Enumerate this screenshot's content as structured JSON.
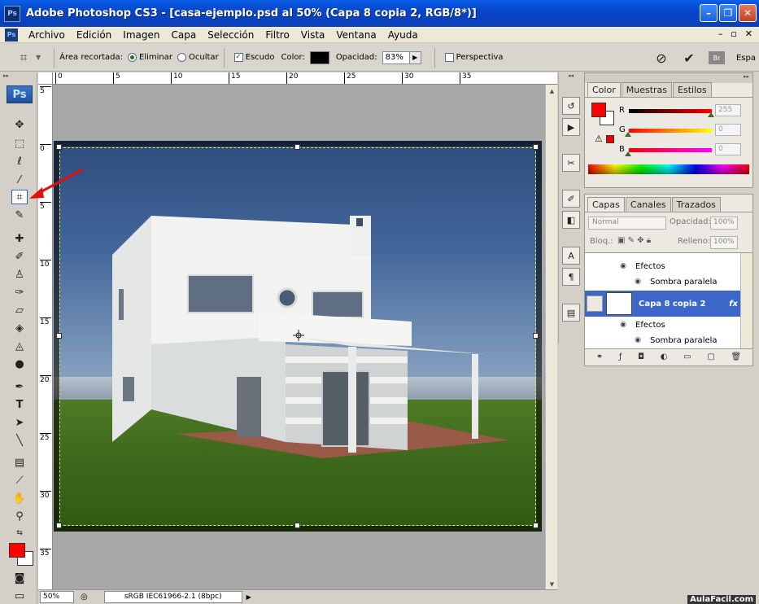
{
  "window": {
    "title": "Adobe Photoshop CS3 - [casa-ejemplo.psd al 50% (Capa 8 copia 2, RGB/8*)]",
    "app_icon_label": "Ps",
    "minimize": "–",
    "restore": "❐",
    "close": "✕"
  },
  "menu": {
    "icon_label": "Ps",
    "items": [
      "Archivo",
      "Edición",
      "Imagen",
      "Capa",
      "Selección",
      "Filtro",
      "Vista",
      "Ventana",
      "Ayuda"
    ],
    "doc_controls": [
      "–",
      "▫",
      "✕"
    ]
  },
  "options": {
    "cropped_area_label": "Área recortada:",
    "delete_label": "Eliminar",
    "hide_label": "Ocultar",
    "shield_label": "Escudo",
    "color_label": "Color:",
    "opacity_label": "Opacidad:",
    "opacity_value": "83%",
    "perspective_label": "Perspectiva",
    "workspace_label": "Espa",
    "bridge_label": "Br"
  },
  "toolbox": {
    "logo": "Ps"
  },
  "rulers": {
    "top": [
      "0",
      "5",
      "10",
      "15",
      "20",
      "25",
      "30",
      "35"
    ],
    "left": [
      "5",
      "0",
      "5",
      "10",
      "15",
      "20",
      "25",
      "30",
      "35"
    ]
  },
  "status": {
    "zoom": "50%",
    "info": "sRGB IEC61966-2.1 (8bpc)"
  },
  "color_panel": {
    "tabs": [
      "Color",
      "Muestras",
      "Estilos"
    ],
    "channels": [
      {
        "label": "R",
        "value": "255",
        "level": 1.0
      },
      {
        "label": "G",
        "value": "0",
        "level": 0.0
      },
      {
        "label": "B",
        "value": "0",
        "level": 0.0
      }
    ]
  },
  "layers_panel": {
    "tabs": [
      "Capas",
      "Canales",
      "Trazados"
    ],
    "blend_mode": "Normal",
    "opacity_label": "Opacidad:",
    "opacity_value": "100%",
    "lock_label": "Bloq.:",
    "fill_label": "Relleno:",
    "fill_value": "100%",
    "effects_label_1": "Efectos",
    "shadow_label_1": "Sombra paralela",
    "selected_layer": "Capa 8 copia 2",
    "fx_label": "fx",
    "effects_label_2": "Efectos",
    "shadow_label_2": "Sombra paralela"
  },
  "watermark": "AulaFacil.com",
  "colors": {
    "foreground": "#ff0000",
    "background": "#ffffff",
    "selection": "#3c66c8"
  }
}
